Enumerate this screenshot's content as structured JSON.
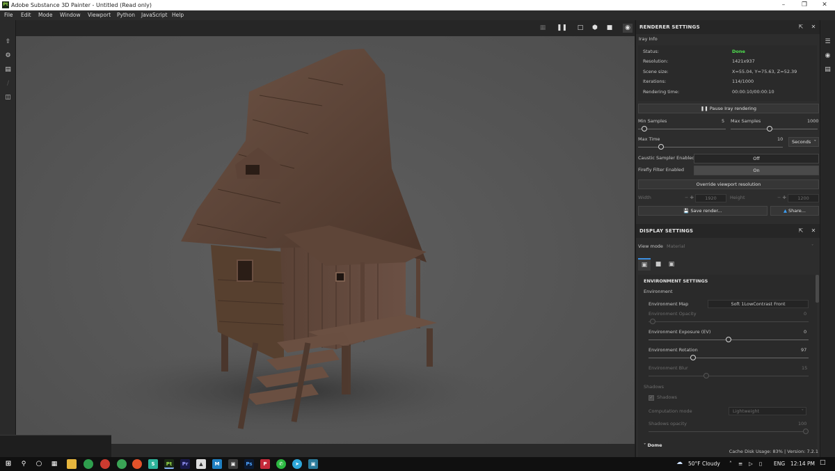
{
  "window": {
    "title": "Adobe Substance 3D Painter - Untitled (Read only)",
    "app_icon": "Pt"
  },
  "menu": [
    "File",
    "Edit",
    "Mode",
    "Window",
    "Viewport",
    "Python",
    "JavaScript",
    "Help"
  ],
  "renderer": {
    "title": "RENDERER SETTINGS",
    "section": "Iray Info",
    "info": [
      {
        "label": "Status:",
        "value": "Done"
      },
      {
        "label": "Resolution:",
        "value": "1421x937"
      },
      {
        "label": "Scene size:",
        "value": "X=55.04, Y=75.63, Z=52.39"
      },
      {
        "label": "Iterations:",
        "value": "114/1000"
      },
      {
        "label": "Rendering time:",
        "value": "00:00:10/00:00:10"
      }
    ],
    "pause_button": "Pause Iray rendering",
    "min_samples": {
      "label": "Min Samples",
      "value": "5"
    },
    "max_samples": {
      "label": "Max Samples",
      "value": "1000"
    },
    "max_time": {
      "label": "Max Time",
      "value": "10",
      "unit": "Seconds"
    },
    "caustic": {
      "label": "Caustic Sampler Enabled",
      "value": "Off"
    },
    "firefly": {
      "label": "Firefly Filter Enabled",
      "value": "On"
    },
    "override_button": "Override viewport resolution",
    "width": {
      "label": "Width",
      "value": "1920"
    },
    "height": {
      "label": "Height",
      "value": "1200"
    },
    "save_button": "Save render...",
    "share_button": "Share..."
  },
  "display": {
    "title": "DISPLAY SETTINGS",
    "view_mode_label": "View mode",
    "view_mode_value": "Material",
    "env_title": "ENVIRONMENT SETTINGS",
    "env_sub": "Environment",
    "env_map": {
      "label": "Environment Map",
      "value": "Soft 1LowContrast Front"
    },
    "env_opacity": {
      "label": "Environment Opacity",
      "value": "0"
    },
    "env_exposure": {
      "label": "Environment Exposure (EV)",
      "value": "0"
    },
    "env_rotation": {
      "label": "Environment Rotation",
      "value": "97"
    },
    "env_blur": {
      "label": "Environment Blur",
      "value": "15"
    },
    "shadows_section": "Shadows",
    "shadows_check": "Shadows",
    "computation_mode": {
      "label": "Computation mode",
      "value": "Lightweight"
    },
    "shadows_opacity": {
      "label": "Shadows opacity",
      "value": "100"
    },
    "dome_section": "Dome"
  },
  "status_bar": "Cache Disk Usage:  83% | Version: 7.2.1",
  "taskbar": {
    "weather": "50°F  Cloudy",
    "language": "ENG",
    "time": "12:14 PM"
  }
}
